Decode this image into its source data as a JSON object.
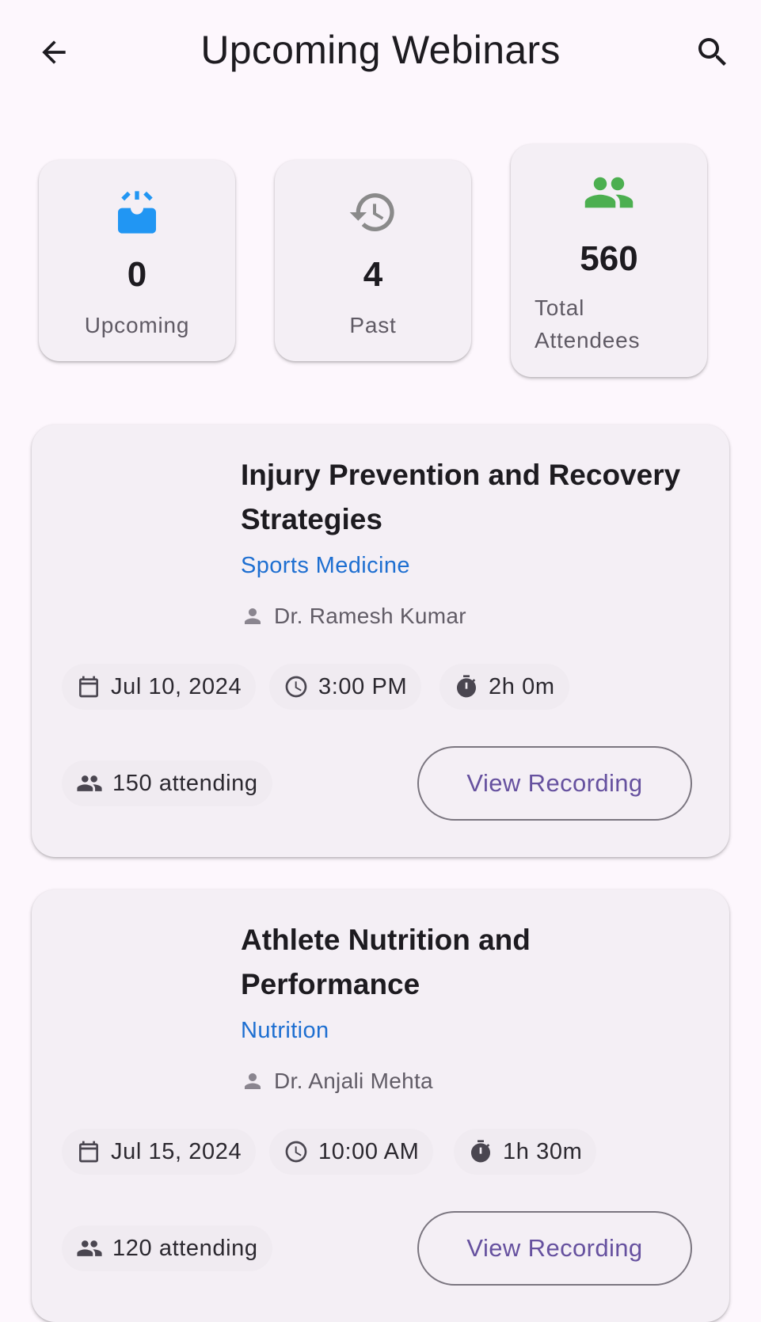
{
  "header": {
    "title": "Upcoming Webinars"
  },
  "stats": [
    {
      "icon": "upcoming-icon",
      "value": "0",
      "label": "Upcoming",
      "color": "#2196f3"
    },
    {
      "icon": "history-icon",
      "value": "4",
      "label": "Past",
      "color": "#808080"
    },
    {
      "icon": "people-icon",
      "value": "560",
      "label_line1": "Total",
      "label_line2": "Attendees",
      "color": "#4caf50"
    }
  ],
  "webinars": [
    {
      "title_line1": "Injury Prevention and Recovery",
      "title_line2": "Strategies",
      "category": "Sports Medicine",
      "speaker": "Dr. Ramesh Kumar",
      "date": "Jul 10, 2024",
      "time": "3:00 PM",
      "duration": "2h 0m",
      "attending": "150 attending",
      "action": "View Recording"
    },
    {
      "title_line1": "Athlete Nutrition and",
      "title_line2": "Performance",
      "category": "Nutrition",
      "speaker": "Dr. Anjali Mehta",
      "date": "Jul 15, 2024",
      "time": "10:00 AM",
      "duration": "1h 30m",
      "attending": "120 attending",
      "action": "View Recording"
    }
  ],
  "colors": {
    "background": "#fdf7fd",
    "card": "#f4eff5",
    "category": "#1e6fd1",
    "button_text": "#66519f"
  }
}
